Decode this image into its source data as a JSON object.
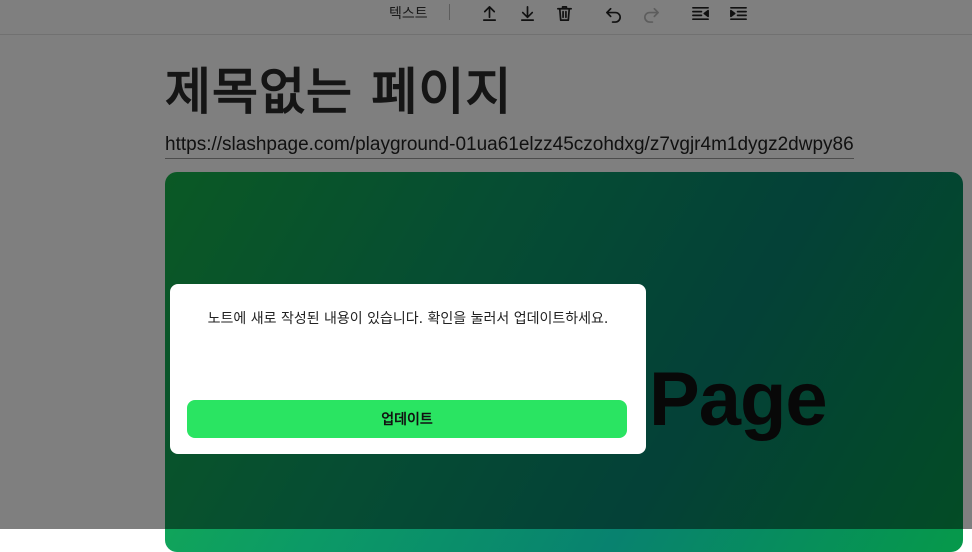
{
  "toolbar": {
    "block_type_label": "텍스트",
    "icons": [
      "move-up-icon",
      "move-down-icon",
      "trash-icon",
      "undo-icon",
      "redo-icon",
      "outdent-icon",
      "indent-icon"
    ]
  },
  "page": {
    "title": "제목없는 페이지",
    "url": "https://slashpage.com/playground-01ua61elzz45czohdxg/z7vgjr4m1dygz2dwpy86",
    "hero_text": "Page"
  },
  "modal": {
    "message": "노트에 새로 작성된 내용이 있습니다. 확인을 눌러서 업데이트하세요.",
    "button_label": "업데이트"
  },
  "colors": {
    "accent": "#2ae462",
    "overlay": "rgba(0,0,0,0.5)"
  }
}
